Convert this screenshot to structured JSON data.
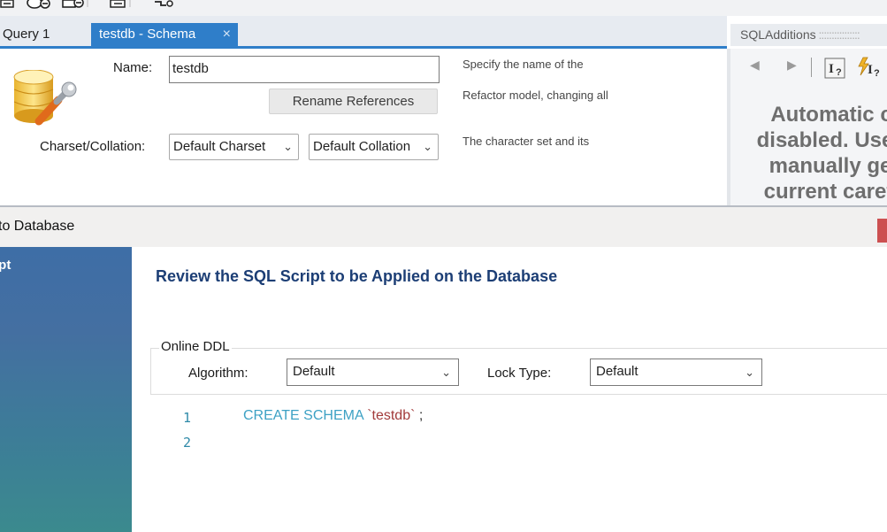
{
  "toolbar": {
    "icons": [
      "open-sql-script-icon",
      "new-schema-icon",
      "new-table-icon",
      "inspect-icon",
      "reconnect-icon"
    ]
  },
  "tabs": [
    {
      "label": "Query 1",
      "active": false
    },
    {
      "label": "testdb - Schema",
      "active": true,
      "close": "×"
    }
  ],
  "schema_editor": {
    "name_label": "Name:",
    "name_value": "testdb",
    "rename_button": "Rename References",
    "charset_label": "Charset/Collation:",
    "charset_value": "Default Charset",
    "collation_value": "Default Collation",
    "hints": [
      "Specify the name of the",
      "Refactor model, changing all",
      "The character set and its"
    ]
  },
  "sql_additions": {
    "title": "SQLAdditions",
    "message_lines": [
      "Automatic c",
      "disabled. Use",
      "manually ge",
      "current caret"
    ]
  },
  "dialog": {
    "title": "to Database",
    "side_step": "ipt",
    "heading": "Review the SQL Script to be Applied on the Database",
    "online_ddl_label": "Online DDL",
    "algorithm_label": "Algorithm:",
    "algorithm_value": "Default",
    "lock_type_label": "Lock Type:",
    "lock_type_value": "Default",
    "script": {
      "line_numbers": [
        "1",
        "2"
      ],
      "keyword": "CREATE SCHEMA",
      "identifier": "`testdb`",
      "terminator": ";"
    }
  },
  "colors": {
    "accent": "#2f7ec9",
    "heading": "#1c3e75",
    "keyword": "#3da1c4",
    "identifier": "#a23a3a",
    "sidebar_top": "#3e6ea6",
    "sidebar_bottom": "#3b8a8e",
    "close_red": "#cc5051"
  }
}
